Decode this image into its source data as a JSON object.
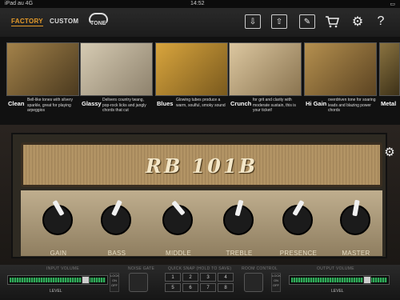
{
  "status": {
    "carrier": "iPad  au  4G",
    "time": "14:52",
    "battery": ""
  },
  "nav": {
    "tab_factory": "FACTORY",
    "tab_custom": "CUSTOM",
    "tone_logo": "TONE",
    "buttons": [
      "download-icon",
      "upload-icon",
      "edit-icon",
      "cart-icon",
      "gear-icon",
      "help-icon"
    ]
  },
  "presets": [
    {
      "name": "Clean",
      "desc": "Bell-like tones with silvery sparkle, great for playing arpeggios",
      "thumb": "#7d6237"
    },
    {
      "name": "Glassy",
      "desc": "Delivers country twang, pop-rock licks and jangly chords that cut",
      "thumb": "#c4b79e"
    },
    {
      "name": "Blues",
      "desc": "Glowing tubes produce a warm, soulful, smoky sound",
      "thumb": "#b8862d"
    },
    {
      "name": "Crunch",
      "desc": "for grit and clarity with moderate sustain, this is your ticket!",
      "thumb": "#cbb58d"
    },
    {
      "name": "Hi Gain",
      "desc": "overdriven tone for soaring leads and blazing power chords",
      "thumb": "#9c7a45"
    },
    {
      "name": "Metal",
      "desc": "",
      "thumb": "#6a5730"
    }
  ],
  "amp": {
    "name": "RB 101B",
    "knobs": [
      {
        "label": "GAIN",
        "angle": -30
      },
      {
        "label": "BASS",
        "angle": 25
      },
      {
        "label": "MIDDLE",
        "angle": -40
      },
      {
        "label": "TREBLE",
        "angle": 15
      },
      {
        "label": "PRESENCE",
        "angle": 30
      },
      {
        "label": "MASTER",
        "angle": 10
      }
    ]
  },
  "bottom": {
    "input_label": "INPUT VOLUME",
    "noise_label": "NOISE GATE",
    "quick_label": "QUICK SNAP (HOLD TO SAVE)",
    "room_label": "ROOM CONTROL",
    "output_label": "OUTPUT VOLUME",
    "level_label": "LEVEL",
    "quick_cells": [
      "1",
      "2",
      "3",
      "4",
      "5",
      "6",
      "7",
      "8"
    ]
  }
}
